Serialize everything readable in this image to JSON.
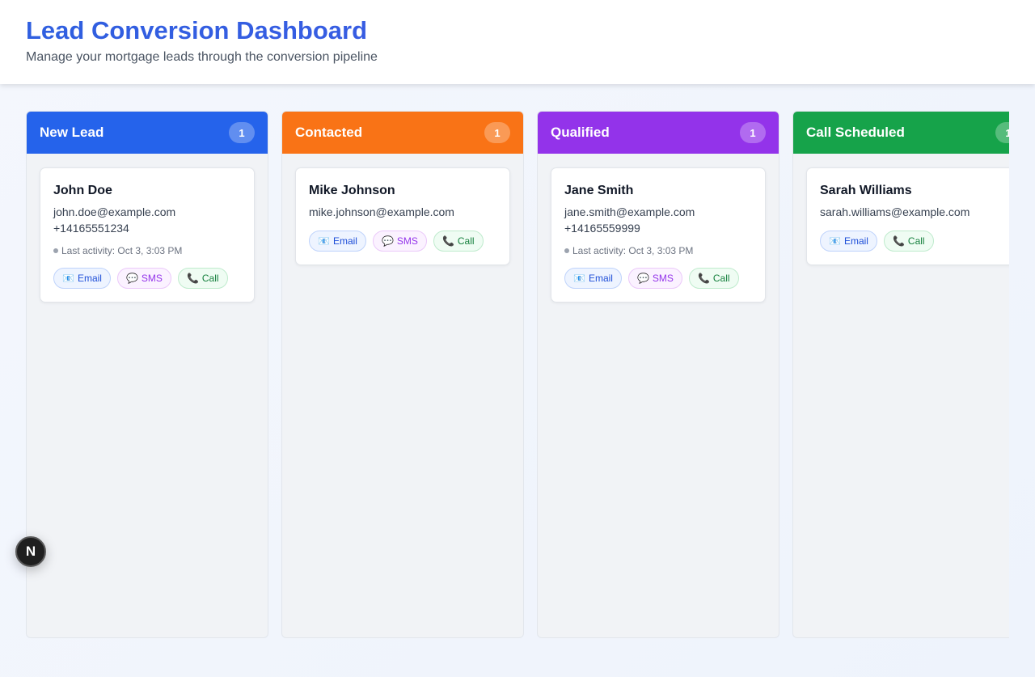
{
  "header": {
    "title": "Lead Conversion Dashboard",
    "subtitle": "Manage your mortgage leads through the conversion pipeline"
  },
  "columns": [
    {
      "title": "New Lead",
      "count": "1",
      "color": "#2563eb",
      "card": {
        "name": "John Doe",
        "email": "john.doe@example.com",
        "phone": "+14165551234",
        "activity": "Last activity: Oct 3, 3:03 PM"
      }
    },
    {
      "title": "Contacted",
      "count": "1",
      "color": "#f97316",
      "card": {
        "name": "Mike Johnson",
        "email": "mike.johnson@example.com"
      }
    },
    {
      "title": "Qualified",
      "count": "1",
      "color": "#9333ea",
      "card": {
        "name": "Jane Smith",
        "email": "jane.smith@example.com",
        "phone": "+14165559999",
        "activity": "Last activity: Oct 3, 3:03 PM"
      }
    },
    {
      "title": "Call Scheduled",
      "count": "1",
      "color": "#16a34a",
      "card": {
        "name": "Sarah Williams",
        "email": "sarah.williams@example.com"
      }
    }
  ],
  "actions": {
    "email_label": "Email",
    "sms_label": "SMS",
    "call_label": "Call",
    "email_icon": "📧",
    "sms_icon": "💬",
    "call_icon": "📞"
  },
  "fab": {
    "label": "N"
  }
}
